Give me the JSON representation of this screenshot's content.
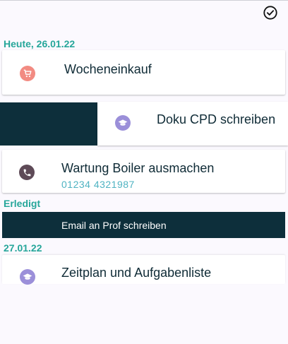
{
  "toolbar": {
    "confirm_icon": "check-circle-icon"
  },
  "sections": {
    "today": "Heute, 26.01.22",
    "done": "Erledigt",
    "next": "27.01.22"
  },
  "tasks": {
    "shopping": {
      "title": "Wocheneinkauf",
      "icon": "cart-icon",
      "icon_color": "#f28b82"
    },
    "doku": {
      "title": "Doku CPD schreiben",
      "icon": "graduation-cap-icon",
      "icon_color": "#9b8fd9"
    },
    "boiler": {
      "title": "Wartung Boiler ausmachen",
      "subtitle": "01234 4321987",
      "icon": "phone-icon",
      "icon_color": "#5e4a57"
    },
    "email": {
      "title": "Email an Prof schreiben"
    },
    "zeitplan": {
      "title": "Zeitplan und Aufgabenliste",
      "icon": "graduation-cap-icon",
      "icon_color": "#9b8fd9"
    }
  },
  "colors": {
    "accent": "#26a69a",
    "dark": "#0d2f3b",
    "phone_text": "#4fb3c2"
  }
}
